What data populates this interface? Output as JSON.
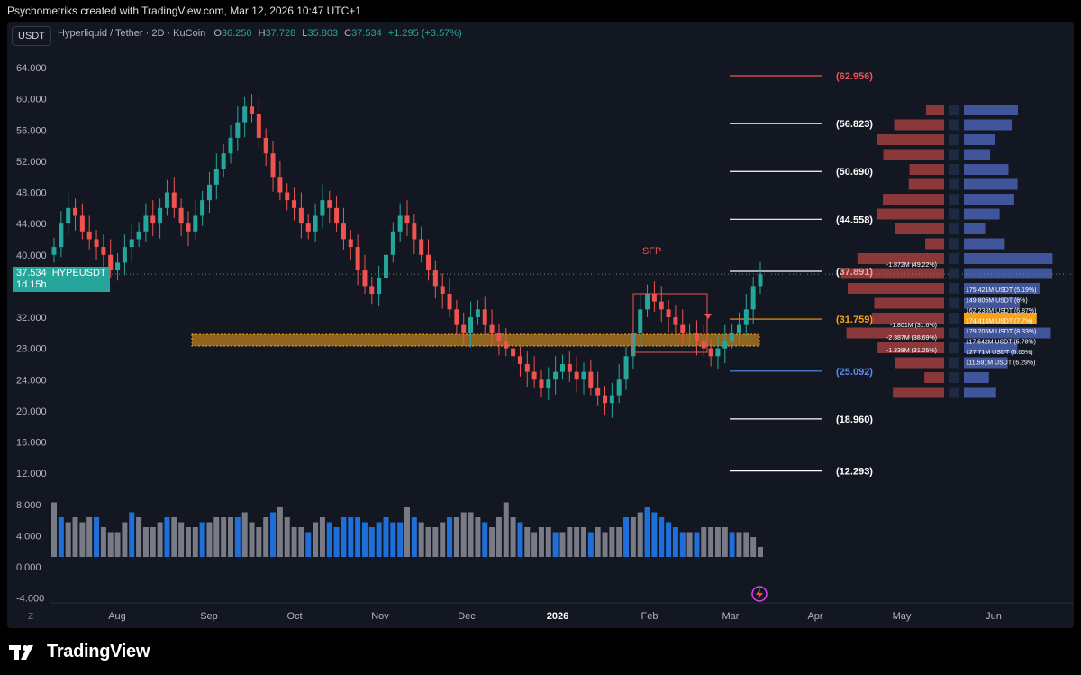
{
  "header": {
    "caption": "Psychometriks created with TradingView.com, Mar 12, 2026 10:47 UTC+1"
  },
  "symbol": {
    "button": "USDT",
    "name": "Hyperliquid / Tether · 2D · KuCoin",
    "o_label": "O",
    "o": "36.250",
    "h_label": "H",
    "h": "37.728",
    "l_label": "L",
    "l": "35.803",
    "c_label": "C",
    "c": "37.534",
    "change": "+1.295 (+3.57%)"
  },
  "last_price": {
    "value": "37.534",
    "ticker": "HYPEUSDT",
    "countdown": "1d 15h"
  },
  "annotations": {
    "sfp": "SFP"
  },
  "footer": {
    "brand": "TradingView",
    "tz_button": "Z"
  },
  "colors": {
    "up": "#26a69a",
    "down": "#ef5350",
    "accent_orange": "#f7a21b",
    "volume_blue": "#1e6fd9",
    "volume_gray": "#787b86"
  },
  "chart_data": {
    "type": "candlestick",
    "y_range": [
      -4,
      66
    ],
    "y_ticks": [
      "64.000",
      "60.000",
      "56.000",
      "52.000",
      "48.000",
      "44.000",
      "40.000",
      "36.000",
      "32.000",
      "28.000",
      "24.000",
      "20.000",
      "16.000",
      "12.000",
      "8.000",
      "4.000",
      "0.000",
      "-4.000"
    ],
    "x_ticks": [
      "Aug",
      "Sep",
      "Oct",
      "Nov",
      "Dec",
      "2026",
      "Feb",
      "Mar",
      "Apr",
      "May",
      "Jun"
    ],
    "levels": [
      {
        "label": "(62.956)",
        "value": 62.956,
        "color": "#ef5350"
      },
      {
        "label": "(56.823)",
        "value": 56.823,
        "color": "#ffffff"
      },
      {
        "label": "(50.690)",
        "value": 50.69,
        "color": "#ffffff"
      },
      {
        "label": "(44.558)",
        "value": 44.558,
        "color": "#ffffff"
      },
      {
        "label": "(37.891)",
        "value": 37.891,
        "color": "#ffffff"
      },
      {
        "label": "(31.759)",
        "value": 31.759,
        "color": "#f7a21b"
      },
      {
        "label": "(25.092)",
        "value": 25.092,
        "color": "#5b8def"
      },
      {
        "label": "(18.960)",
        "value": 18.96,
        "color": "#ffffff"
      },
      {
        "label": "(12.293)",
        "value": 12.293,
        "color": "#ffffff"
      }
    ],
    "zone": {
      "top": 29.8,
      "bottom": 28.3
    },
    "close_series": [
      41,
      44,
      46,
      45,
      43,
      42,
      41,
      40,
      38,
      39,
      41,
      42,
      43,
      45,
      44,
      46,
      48,
      46,
      44,
      43,
      45,
      47,
      49,
      51,
      53,
      55,
      57,
      59,
      58,
      55,
      53,
      50,
      48,
      47,
      46,
      44,
      43,
      45,
      47,
      46,
      44,
      42,
      41,
      38,
      36,
      35,
      37,
      40,
      43,
      45,
      44,
      42,
      40,
      38,
      36,
      35,
      33,
      31,
      30,
      32,
      33,
      31,
      30,
      29,
      28,
      27,
      26,
      25,
      24,
      23,
      24,
      25,
      26,
      25,
      24,
      25,
      23,
      22,
      21,
      22,
      24,
      27,
      30,
      33,
      35,
      34,
      33,
      32,
      31,
      30,
      30,
      29,
      28,
      27,
      28,
      29,
      30,
      31,
      33,
      36,
      37.5
    ],
    "volume": [
      11,
      8,
      7,
      8,
      7,
      8,
      8,
      6,
      5,
      5,
      7,
      9,
      8,
      6,
      6,
      7,
      8,
      8,
      7,
      6,
      6,
      7,
      7,
      8,
      8,
      8,
      8,
      9,
      7,
      6,
      8,
      9,
      10,
      8,
      6,
      6,
      5,
      7,
      8,
      7,
      6,
      8,
      8,
      8,
      7,
      6,
      7,
      8,
      7,
      7,
      10,
      8,
      7,
      6,
      6,
      7,
      8,
      8,
      9,
      9,
      8,
      7,
      6,
      8,
      11,
      8,
      7,
      6,
      5,
      6,
      6,
      5,
      5,
      6,
      6,
      6,
      5,
      6,
      5,
      6,
      6,
      8,
      8,
      9,
      10,
      9,
      8,
      7,
      6,
      5,
      5,
      5,
      6,
      6,
      6,
      6,
      5,
      5,
      5,
      4,
      2
    ]
  },
  "volume_profile": {
    "left_labels": [
      "-1.872M (49.22%)",
      "-1.801M (31.6%)",
      "-2.387M (38.69%)",
      "-1.338M (31.25%)"
    ],
    "right_labels": [
      "175.421M USDT (5.19%)",
      "149.805M USDT (6%)",
      "162.238M USDT (6.87%)",
      "174.414M USDT (7.7%)",
      "179.205M USDT (8.33%)",
      "117.642M USDT (5.78%)",
      "127.71M USDT (6.65%)",
      "111.591M USDT (6.29%)"
    ]
  }
}
